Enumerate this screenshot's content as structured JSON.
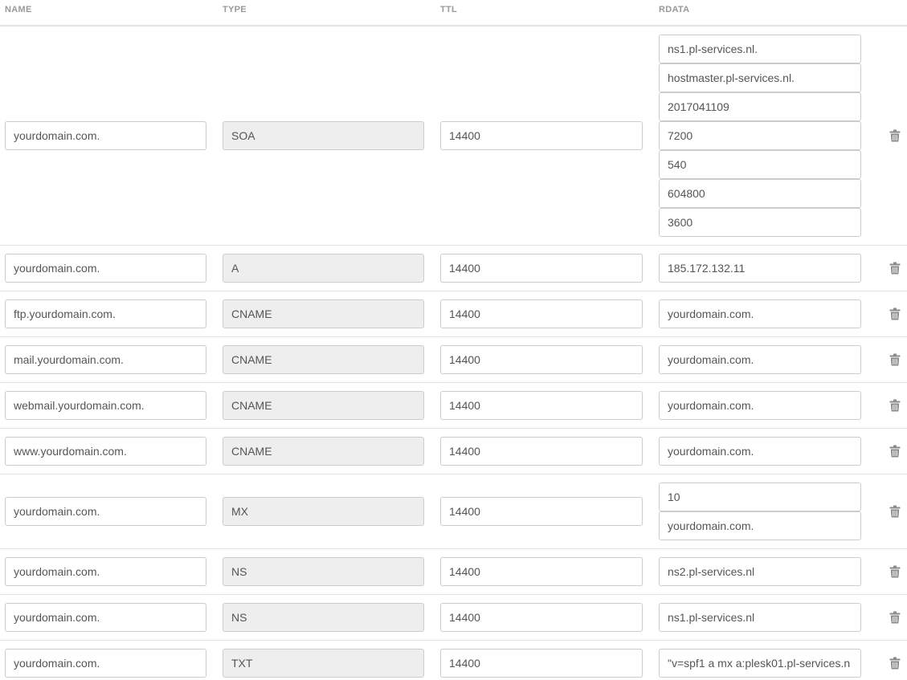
{
  "headers": {
    "name": "NAME",
    "type": "TYPE",
    "ttl": "TTL",
    "rdata": "RDATA"
  },
  "icons": {
    "delete": "trash-icon"
  },
  "records": [
    {
      "name": "yourdomain.com.",
      "type": "SOA",
      "ttl": "14400",
      "rdata": [
        "ns1.pl-services.nl.",
        "hostmaster.pl-services.nl.",
        "2017041109",
        "7200",
        "540",
        "604800",
        "3600"
      ]
    },
    {
      "name": "yourdomain.com.",
      "type": "A",
      "ttl": "14400",
      "rdata": [
        "185.172.132.11"
      ]
    },
    {
      "name": "ftp.yourdomain.com.",
      "type": "CNAME",
      "ttl": "14400",
      "rdata": [
        "yourdomain.com."
      ]
    },
    {
      "name": "mail.yourdomain.com.",
      "type": "CNAME",
      "ttl": "14400",
      "rdata": [
        "yourdomain.com."
      ]
    },
    {
      "name": "webmail.yourdomain.com.",
      "type": "CNAME",
      "ttl": "14400",
      "rdata": [
        "yourdomain.com."
      ]
    },
    {
      "name": "www.yourdomain.com.",
      "type": "CNAME",
      "ttl": "14400",
      "rdata": [
        "yourdomain.com."
      ]
    },
    {
      "name": "yourdomain.com.",
      "type": "MX",
      "ttl": "14400",
      "rdata": [
        "10",
        "yourdomain.com."
      ]
    },
    {
      "name": "yourdomain.com.",
      "type": "NS",
      "ttl": "14400",
      "rdata": [
        "ns2.pl-services.nl"
      ]
    },
    {
      "name": "yourdomain.com.",
      "type": "NS",
      "ttl": "14400",
      "rdata": [
        "ns1.pl-services.nl"
      ]
    },
    {
      "name": "yourdomain.com.",
      "type": "TXT",
      "ttl": "14400",
      "rdata": [
        "\"v=spf1 a mx a:plesk01.pl-services.n"
      ]
    }
  ]
}
